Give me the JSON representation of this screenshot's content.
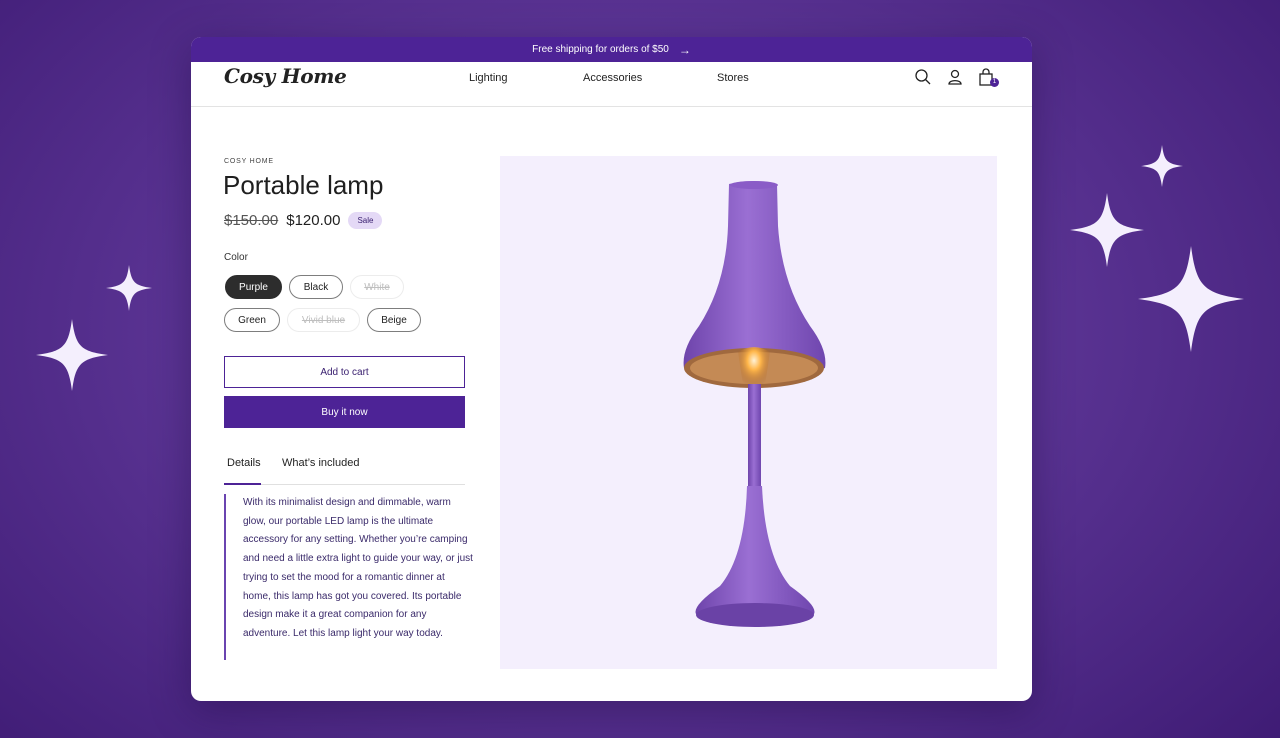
{
  "announcement": {
    "text": "Free shipping for orders of $50",
    "arrow": "→"
  },
  "header": {
    "logo": "Cosy Home",
    "nav": [
      "Lighting",
      "Accessories",
      "Stores"
    ],
    "icons": [
      "search-icon",
      "account-icon",
      "cart-icon"
    ],
    "cart_count": "1"
  },
  "product": {
    "vendor": "COSY HOME",
    "title": "Portable lamp",
    "price_old": "$150.00",
    "price_new": "$120.00",
    "badge": "Sale",
    "color_label": "Color",
    "colors": [
      {
        "label": "Purple",
        "state": "selected"
      },
      {
        "label": "Black",
        "state": "available"
      },
      {
        "label": "White",
        "state": "unavailable"
      },
      {
        "label": "Green",
        "state": "available"
      },
      {
        "label": "Vivid blue",
        "state": "unavailable"
      },
      {
        "label": "Beige",
        "state": "available"
      }
    ],
    "add_to_cart": "Add to cart",
    "buy_now": "Buy it now",
    "tabs": [
      "Details",
      "What’s included"
    ],
    "description": "With its minimalist design and dimmable, warm glow, our portable LED lamp is the ultimate accessory for any setting. Whether you’re camping and need a little extra light to guide your way, or just trying to set the mood for a romantic dinner at home, this lamp has got you covered. Its portable design make it a great companion for any adventure. Let this lamp light your way today."
  },
  "colors": {
    "brand": "#4d2396",
    "image_bg": "#f4effd",
    "lamp": "#8a5cc7",
    "page_bg": "#5c3595"
  }
}
